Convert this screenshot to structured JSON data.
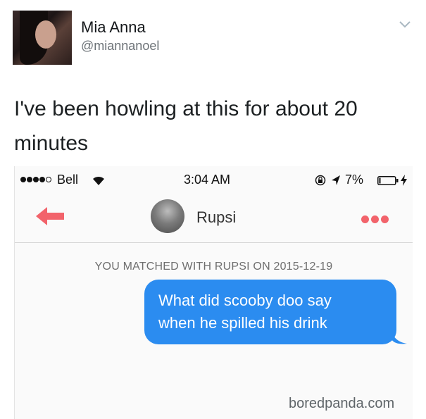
{
  "tweet": {
    "display_name": "Mia Anna",
    "handle": "@miannanoel",
    "text_lines": [
      "I've been howling at this for about 20",
      "minutes"
    ],
    "menu_icon": "chevron-down-icon"
  },
  "phone": {
    "status_bar": {
      "carrier": "Bell",
      "time": "3:04 AM",
      "battery_percent": "7%",
      "signal_bars_filled": 4,
      "signal_bars_total": 5
    },
    "chat": {
      "contact_name": "Rupsi",
      "matched_notice": "YOU MATCHED WITH RUPSI ON 2015-12-19",
      "messages": [
        {
          "from": "me",
          "lines": [
            "What did scooby doo say",
            "when he spilled his drink"
          ]
        }
      ]
    },
    "colors": {
      "accent": "#f2636b",
      "bubble": "#2b8cf0"
    }
  },
  "watermark": "boredpanda.com"
}
